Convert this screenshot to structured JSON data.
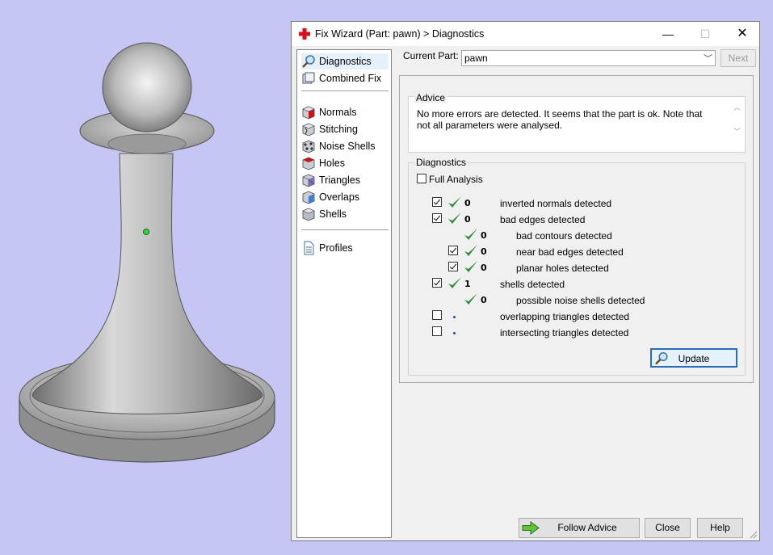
{
  "window": {
    "title": "Fix Wizard (Part: pawn) > Diagnostics",
    "minimize_glyph": "—",
    "maximize_glyph": "☐",
    "close_glyph": "✕"
  },
  "nav": {
    "items": [
      {
        "label": "Diagnostics",
        "icon": "magnifier-icon",
        "selected": true
      },
      {
        "label": "Combined Fix",
        "icon": "combined-fix-icon"
      },
      {
        "label": "Normals",
        "icon": "normals-cube-icon"
      },
      {
        "label": "Stitching",
        "icon": "stitching-cube-icon"
      },
      {
        "label": "Noise Shells",
        "icon": "noise-shells-icon"
      },
      {
        "label": "Holes",
        "icon": "holes-cube-icon"
      },
      {
        "label": "Triangles",
        "icon": "triangles-cube-icon"
      },
      {
        "label": "Overlaps",
        "icon": "overlaps-cube-icon"
      },
      {
        "label": "Shells",
        "icon": "shells-cube-icon"
      },
      {
        "label": "Profiles",
        "icon": "document-icon"
      }
    ]
  },
  "current_part": {
    "label": "Current Part:",
    "value": "pawn",
    "next_label": "Next"
  },
  "advice": {
    "title": "Advice",
    "text": "No more errors are detected. It seems that the part is ok. Note that not all parameters were analysed."
  },
  "diagnostics": {
    "title": "Diagnostics",
    "full_analysis_label": "Full Analysis",
    "full_analysis_checked": false,
    "rows": [
      {
        "count": "0",
        "label": "inverted normals detected",
        "checked": true
      },
      {
        "count": "0",
        "label": "bad edges detected",
        "checked": true
      },
      {
        "count": "0",
        "label": "bad contours detected"
      },
      {
        "count": "0",
        "label": "near bad edges detected",
        "checked": true
      },
      {
        "count": "0",
        "label": "planar holes detected",
        "checked": true
      },
      {
        "count": "1",
        "label": "shells detected",
        "checked": true
      },
      {
        "count": "0",
        "label": "possible noise shells detected"
      },
      {
        "count": "",
        "label": "overlapping triangles detected",
        "checked": false
      },
      {
        "count": "",
        "label": "intersecting triangles detected",
        "checked": false
      }
    ],
    "update_label": "Update"
  },
  "buttons": {
    "follow_advice": "Follow Advice",
    "close": "Close",
    "help": "Help"
  },
  "colors": {
    "background": "#c6c6f4",
    "check_green": "#2e8b3e",
    "accent_blue": "#2b6cb8"
  }
}
